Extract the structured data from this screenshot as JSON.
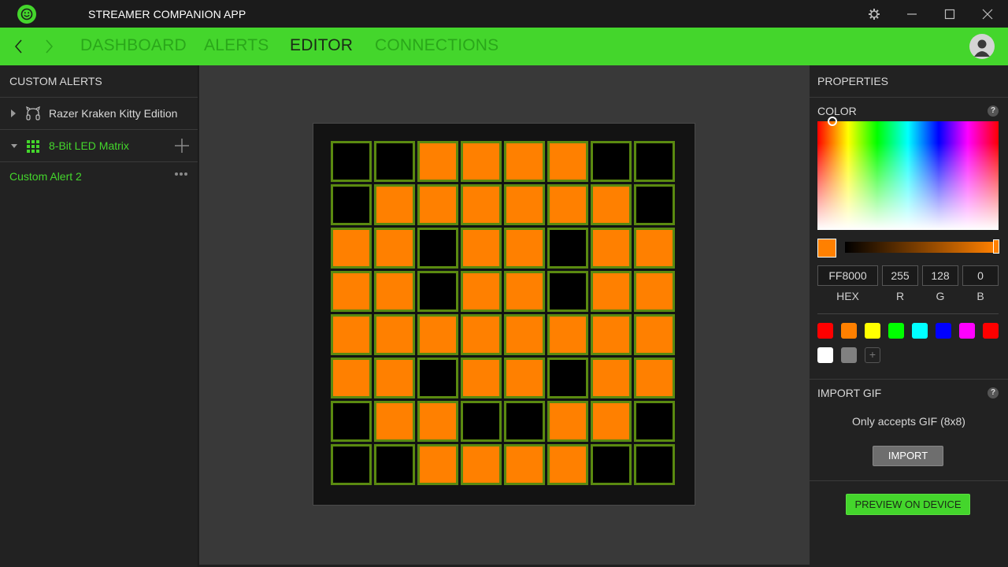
{
  "window": {
    "title": "STREAMER COMPANION APP",
    "icons": [
      "razer-logo-icon",
      "gear-icon",
      "minimize-icon",
      "maximize-icon",
      "close-icon"
    ]
  },
  "nav": {
    "tabs": [
      {
        "label": "DASHBOARD",
        "active": false
      },
      {
        "label": "ALERTS",
        "active": false
      },
      {
        "label": "EDITOR",
        "active": true
      },
      {
        "label": "CONNECTIONS",
        "active": false
      }
    ]
  },
  "sidebar": {
    "title": "CUSTOM ALERTS",
    "groups": [
      {
        "label": "Razer Kraken Kitty Edition",
        "expanded": false,
        "icon": "headset-icon"
      },
      {
        "label": "8-Bit LED Matrix",
        "expanded": true,
        "icon": "led-grid-icon"
      }
    ],
    "items": [
      {
        "label": "Custom Alert 2"
      }
    ]
  },
  "matrix": {
    "rows": 8,
    "cols": 8,
    "on_color": "#FF8000",
    "off_color": "#000000",
    "pattern": [
      [
        0,
        0,
        1,
        1,
        1,
        1,
        0,
        0
      ],
      [
        0,
        1,
        1,
        1,
        1,
        1,
        1,
        0
      ],
      [
        1,
        1,
        0,
        1,
        1,
        0,
        1,
        1
      ],
      [
        1,
        1,
        0,
        1,
        1,
        0,
        1,
        1
      ],
      [
        1,
        1,
        1,
        1,
        1,
        1,
        1,
        1
      ],
      [
        1,
        1,
        0,
        1,
        1,
        0,
        1,
        1
      ],
      [
        0,
        1,
        1,
        0,
        0,
        1,
        1,
        0
      ],
      [
        0,
        0,
        1,
        1,
        1,
        1,
        0,
        0
      ]
    ]
  },
  "properties": {
    "title": "PROPERTIES",
    "color": {
      "title": "COLOR",
      "current": "#FF8000",
      "brightness_percent": 100,
      "hex": "FF8000",
      "r": "255",
      "g": "128",
      "b": "0",
      "labels": {
        "hex": "HEX",
        "r": "R",
        "g": "G",
        "b": "B"
      },
      "presets": [
        "#FF0000",
        "#FF8000",
        "#FFFF00",
        "#00FF00",
        "#00FFFF",
        "#0000FF",
        "#FF00FF",
        "#FF0000",
        "#FFFFFF",
        "#808080"
      ],
      "add_preset_label": "+"
    },
    "import_gif": {
      "title": "IMPORT GIF",
      "note": "Only accepts GIF (8x8)",
      "button": "IMPORT"
    },
    "preview_button": "PREVIEW ON DEVICE",
    "help_label": "?"
  }
}
